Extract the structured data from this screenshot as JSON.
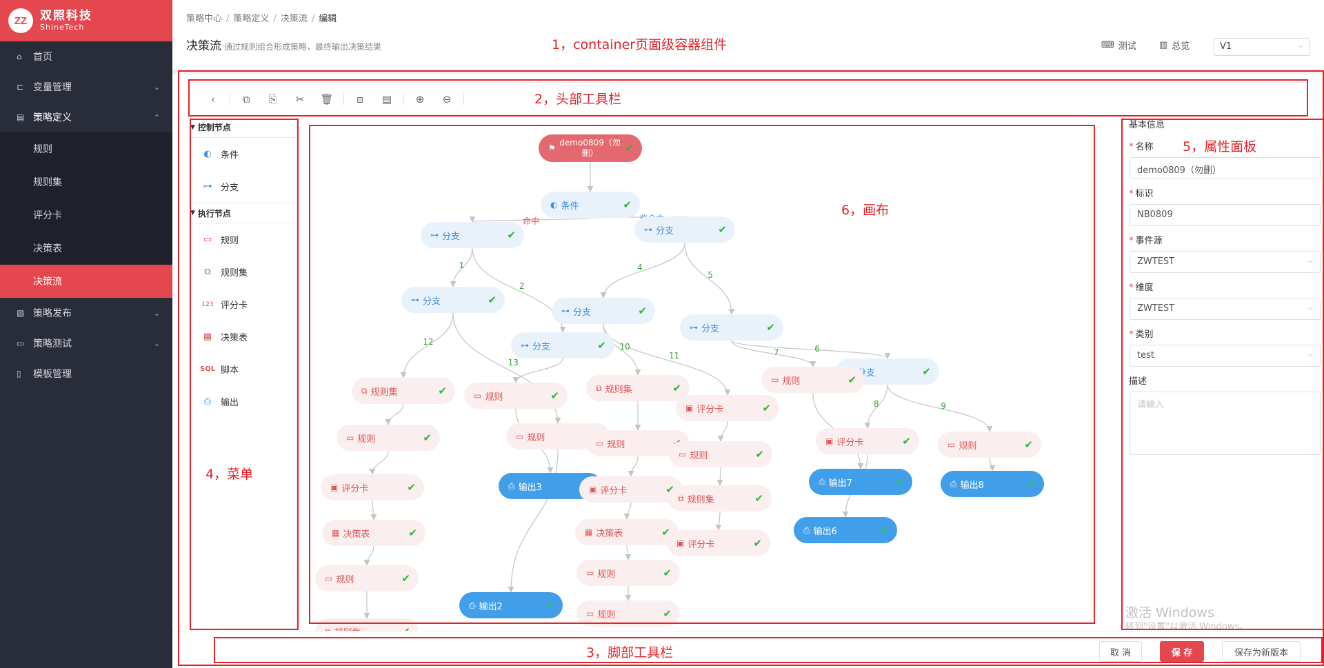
{
  "sidebar": {
    "logo_mark": "ZZ",
    "brand": "双照科技",
    "brand_en": "ShineTech",
    "items": [
      {
        "label": "首页"
      },
      {
        "label": "变量管理"
      },
      {
        "label": "策略定义"
      },
      {
        "label": "策略发布"
      },
      {
        "label": "策略测试"
      },
      {
        "label": "模板管理"
      }
    ],
    "sub_items": [
      {
        "label": "规则"
      },
      {
        "label": "规则集"
      },
      {
        "label": "评分卡"
      },
      {
        "label": "决策表"
      },
      {
        "label": "决策流"
      }
    ]
  },
  "breadcrumb": [
    "策略中心",
    "策略定义",
    "决策流",
    "编辑"
  ],
  "header": {
    "title": "决策流",
    "description": "通过规则组合形成策略，最终输出决策结果",
    "test_label": "测试",
    "overview_label": "总览",
    "version": "V1"
  },
  "node_menu": {
    "control_group": "控制节点",
    "control_items": [
      {
        "label": "条件",
        "icon": "condition-icon"
      },
      {
        "label": "分支",
        "icon": "branch-icon"
      }
    ],
    "exec_group": "执行节点",
    "exec_items": [
      {
        "label": "规则",
        "icon": "rule-icon"
      },
      {
        "label": "规则集",
        "icon": "ruleset-icon"
      },
      {
        "label": "评分卡",
        "icon": "scorecard-icon"
      },
      {
        "label": "决策表",
        "icon": "decision-table-icon"
      },
      {
        "label": "脚本",
        "icon": "sql-icon",
        "glyph": "SQL"
      },
      {
        "label": "输出",
        "icon": "output-icon"
      }
    ]
  },
  "canvas": {
    "nodes": [
      {
        "id": "start",
        "kind": "start",
        "label": "demo0809（勿删）"
      },
      {
        "id": "cond",
        "kind": "ctrl",
        "icon": "condition",
        "label": "条件"
      },
      {
        "id": "b1",
        "kind": "ctrl",
        "icon": "branch",
        "label": "分支"
      },
      {
        "id": "b2",
        "kind": "ctrl",
        "icon": "branch",
        "label": "分支"
      },
      {
        "id": "b3",
        "kind": "ctrl",
        "icon": "branch",
        "label": "分支"
      },
      {
        "id": "b4",
        "kind": "ctrl",
        "icon": "branch",
        "label": "分支"
      },
      {
        "id": "b5",
        "kind": "ctrl",
        "icon": "branch",
        "label": "分支"
      },
      {
        "id": "b6",
        "kind": "ctrl",
        "icon": "branch",
        "label": "分支"
      },
      {
        "id": "b7",
        "kind": "ctrl",
        "icon": "branch",
        "label": "分支"
      },
      {
        "id": "e1",
        "kind": "exec",
        "icon": "ruleset",
        "label": "规则集"
      },
      {
        "id": "e2",
        "kind": "exec",
        "icon": "rule",
        "label": "规则"
      },
      {
        "id": "e3",
        "kind": "exec",
        "icon": "scorecard",
        "label": "评分卡"
      },
      {
        "id": "e4",
        "kind": "exec",
        "icon": "table",
        "label": "决策表"
      },
      {
        "id": "e5",
        "kind": "exec",
        "icon": "rule",
        "label": "规则"
      },
      {
        "id": "e6",
        "kind": "exec",
        "icon": "ruleset",
        "label": "规则集"
      },
      {
        "id": "e7",
        "kind": "exec",
        "icon": "rule",
        "label": "规则"
      },
      {
        "id": "e8",
        "kind": "exec",
        "icon": "rule",
        "label": "规则"
      },
      {
        "id": "o3",
        "kind": "out",
        "label": "输出3"
      },
      {
        "id": "o2",
        "kind": "out",
        "label": "输出2"
      },
      {
        "id": "e9",
        "kind": "exec",
        "icon": "ruleset",
        "label": "规则集"
      },
      {
        "id": "e10",
        "kind": "exec",
        "icon": "rule",
        "label": "规则"
      },
      {
        "id": "e11",
        "kind": "exec",
        "icon": "scorecard",
        "label": "评分卡"
      },
      {
        "id": "e12",
        "kind": "exec",
        "icon": "table",
        "label": "决策表"
      },
      {
        "id": "e13",
        "kind": "exec",
        "icon": "rule",
        "label": "规则"
      },
      {
        "id": "e14",
        "kind": "exec",
        "icon": "rule",
        "label": "规则"
      },
      {
        "id": "e15",
        "kind": "exec",
        "icon": "scorecard",
        "label": "评分卡"
      },
      {
        "id": "e16",
        "kind": "exec",
        "icon": "rule",
        "label": "规则"
      },
      {
        "id": "e17",
        "kind": "exec",
        "icon": "ruleset",
        "label": "规则集"
      },
      {
        "id": "e18",
        "kind": "exec",
        "icon": "scorecard",
        "label": "评分卡"
      },
      {
        "id": "e19",
        "kind": "exec",
        "icon": "rule",
        "label": "规则"
      },
      {
        "id": "e20",
        "kind": "exec",
        "icon": "scorecard",
        "label": "评分卡"
      },
      {
        "id": "e21",
        "kind": "exec",
        "icon": "rule",
        "label": "规则"
      },
      {
        "id": "o7",
        "kind": "out",
        "label": "输出7"
      },
      {
        "id": "o6",
        "kind": "out",
        "label": "输出6"
      },
      {
        "id": "o8",
        "kind": "out",
        "label": "输出8"
      }
    ],
    "edges": [
      {
        "from": "start",
        "to": "cond",
        "label": ""
      },
      {
        "from": "cond",
        "to": "b1",
        "label": "命中"
      },
      {
        "from": "cond",
        "to": "b2",
        "label": "非命中"
      },
      {
        "from": "b1",
        "to": "b3",
        "label": "1"
      },
      {
        "from": "b1",
        "to": "b4",
        "label": "2"
      },
      {
        "from": "b2",
        "to": "b5",
        "label": "4"
      },
      {
        "from": "b2",
        "to": "b6",
        "label": "5"
      },
      {
        "from": "b3",
        "to": "e1",
        "label": "12"
      },
      {
        "from": "b3",
        "to": "e8",
        "label": "13"
      },
      {
        "from": "e1",
        "to": "e2",
        "label": ""
      },
      {
        "from": "e2",
        "to": "e3",
        "label": ""
      },
      {
        "from": "e3",
        "to": "e4",
        "label": ""
      },
      {
        "from": "e4",
        "to": "e5",
        "label": ""
      },
      {
        "from": "e5",
        "to": "e6",
        "label": ""
      },
      {
        "from": "b4",
        "to": "e7",
        "label": ""
      },
      {
        "from": "e7",
        "to": "o3",
        "label": ""
      },
      {
        "from": "e8",
        "to": "o2",
        "label": ""
      },
      {
        "from": "b5",
        "to": "e9",
        "label": "10"
      },
      {
        "from": "b5",
        "to": "e15",
        "label": "11"
      },
      {
        "from": "e9",
        "to": "e10",
        "label": ""
      },
      {
        "from": "e10",
        "to": "e11",
        "label": ""
      },
      {
        "from": "e11",
        "to": "e12",
        "label": ""
      },
      {
        "from": "e12",
        "to": "e13",
        "label": ""
      },
      {
        "from": "e13",
        "to": "e14",
        "label": ""
      },
      {
        "from": "e15",
        "to": "e16",
        "label": ""
      },
      {
        "from": "e16",
        "to": "e17",
        "label": ""
      },
      {
        "from": "e17",
        "to": "e18",
        "label": ""
      },
      {
        "from": "b6",
        "to": "e19",
        "label": "7"
      },
      {
        "from": "b6",
        "to": "b7",
        "label": "6"
      },
      {
        "from": "e19",
        "to": "o7",
        "label": ""
      },
      {
        "from": "b7",
        "to": "e20",
        "label": "8"
      },
      {
        "from": "b7",
        "to": "e21",
        "label": "9"
      },
      {
        "from": "e20",
        "to": "o6",
        "label": ""
      },
      {
        "from": "e21",
        "to": "o8",
        "label": ""
      }
    ]
  },
  "props": {
    "title": "基本信息",
    "name_label": "名称",
    "name_value": "demo0809（勿删）",
    "code_label": "标识",
    "code_value": "NB0809",
    "event_label": "事件源",
    "event_value": "ZWTEST",
    "dim_label": "维度",
    "dim_value": "ZWTEST",
    "type_label": "类别",
    "type_value": "test",
    "desc_label": "描述",
    "desc_placeholder": "请输入"
  },
  "footer": {
    "cancel": "取 消",
    "save": "保 存",
    "save_new": "保存为新版本"
  },
  "watermark": {
    "line1": "激活 Windows",
    "line2": "转到\"设置\"以激活 Windows。"
  },
  "annotations": [
    "1，container页面级容器组件",
    "2，头部工具栏",
    "3，脚部工具栏",
    "4，菜单",
    "5，属性面板",
    "6，画布"
  ],
  "colors": {
    "brand": "#e4474e",
    "sidebar_bg": "#292d3a",
    "control_node": "#e9f2fb",
    "exec_node": "#fbeeee",
    "output_node": "#419ee8",
    "annotation": "#e5222a"
  }
}
